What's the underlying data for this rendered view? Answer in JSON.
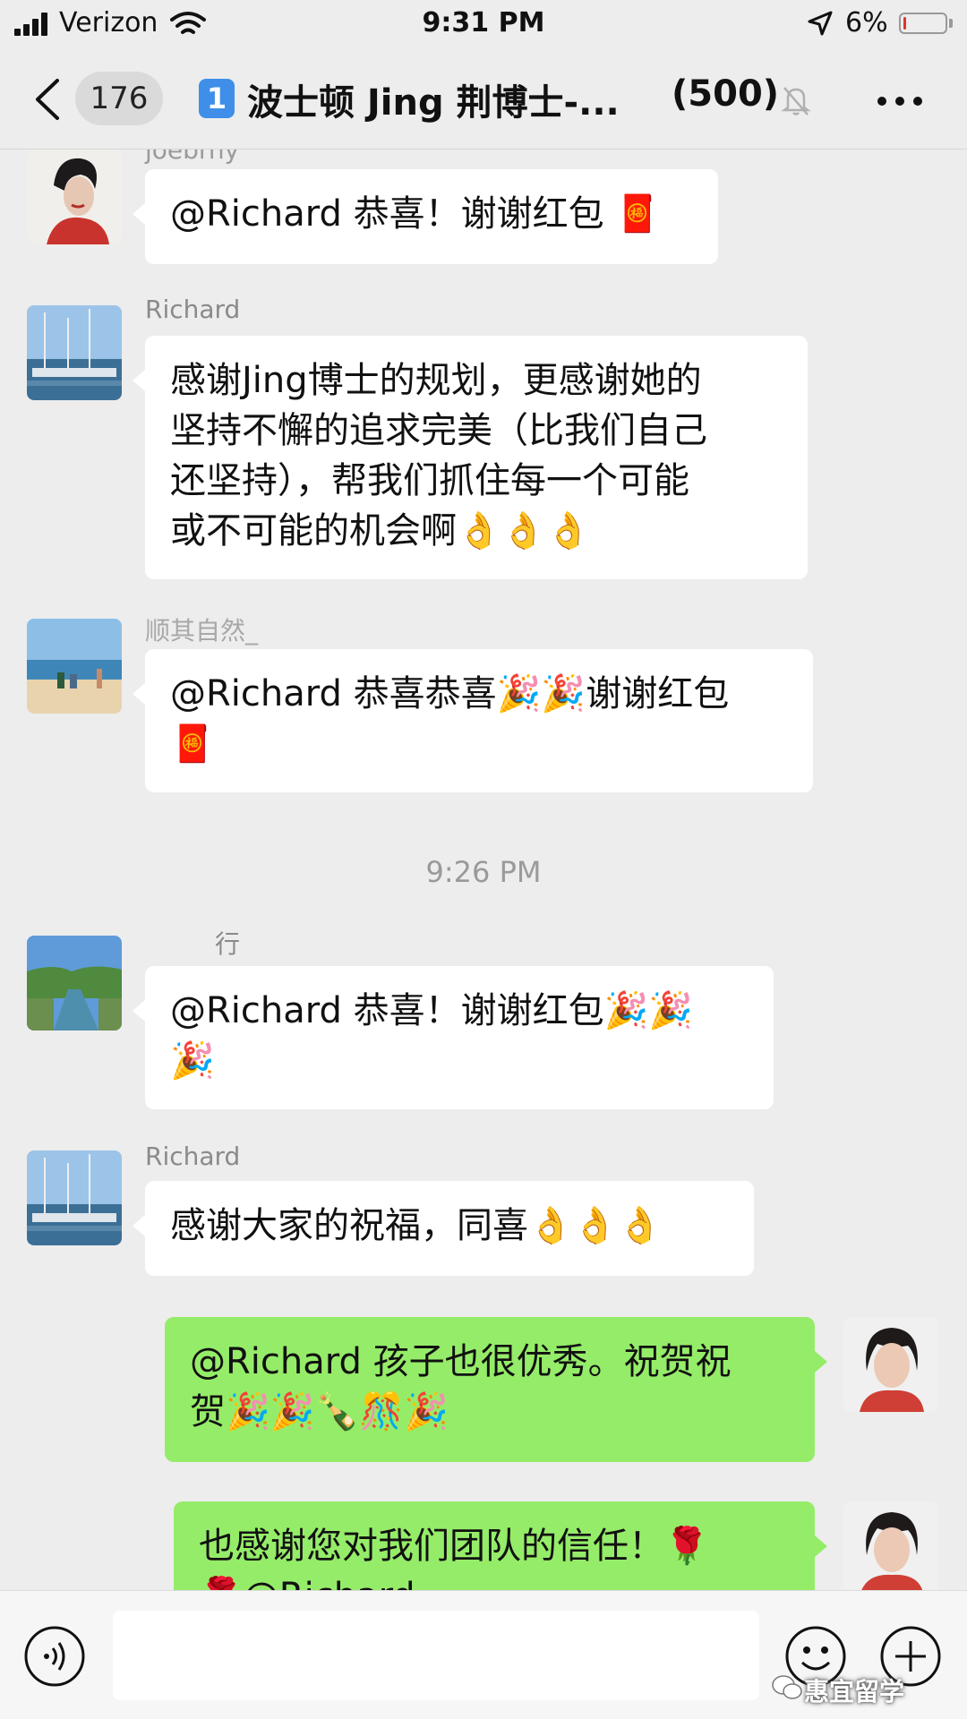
{
  "status_bar": {
    "carrier": "Verizon",
    "time": "9:31 PM",
    "battery": "6%",
    "battery_level": 0.06
  },
  "nav": {
    "unread_count": "176",
    "group_badge": "1",
    "title": "波士顿 Jing 荆博士-...",
    "member_count": "(500)"
  },
  "messages": [
    {
      "sender": "joebrny",
      "text": "@Richard 恭喜！谢谢红包 🧧"
    },
    {
      "sender": "Richard",
      "lines": [
        "感谢Jing博士的规划，更感谢她的",
        "坚持不懈的追求完美（比我们自己",
        "还坚持），帮我们抓住每一个可能",
        "或不可能的机会啊👌👌👌"
      ]
    },
    {
      "sender": "顺其自然_",
      "lines": [
        "@Richard 恭喜恭喜🎉🎉谢谢红包",
        "🧧"
      ]
    },
    {
      "timestamp": "9:26 PM"
    },
    {
      "sender": "行",
      "lines": [
        "@Richard 恭喜！谢谢红包🎉🎉",
        "🎉"
      ]
    },
    {
      "sender": "Richard",
      "text": "感谢大家的祝福，同喜👌👌👌"
    },
    {
      "lines": [
        "@Richard 孩子也很优秀。祝贺祝",
        "贺🎉🎉🍾🎊🎉"
      ]
    },
    {
      "lines": [
        "也感谢您对我们团队的信任！🌹",
        "🌹@Richard"
      ]
    }
  ],
  "watermark": "惠宜留学",
  "colors": {
    "outgoing_bubble": "#95ec69",
    "incoming_bubble": "#ffffff",
    "background": "#ededed",
    "battery_low": "#e0352b"
  },
  "icons": {
    "back": "chevron-left-icon",
    "mute": "bell-slash-icon",
    "more": "ellipsis-icon",
    "voice": "voice-icon",
    "emoji": "smiley-icon",
    "plus": "plus-icon"
  }
}
